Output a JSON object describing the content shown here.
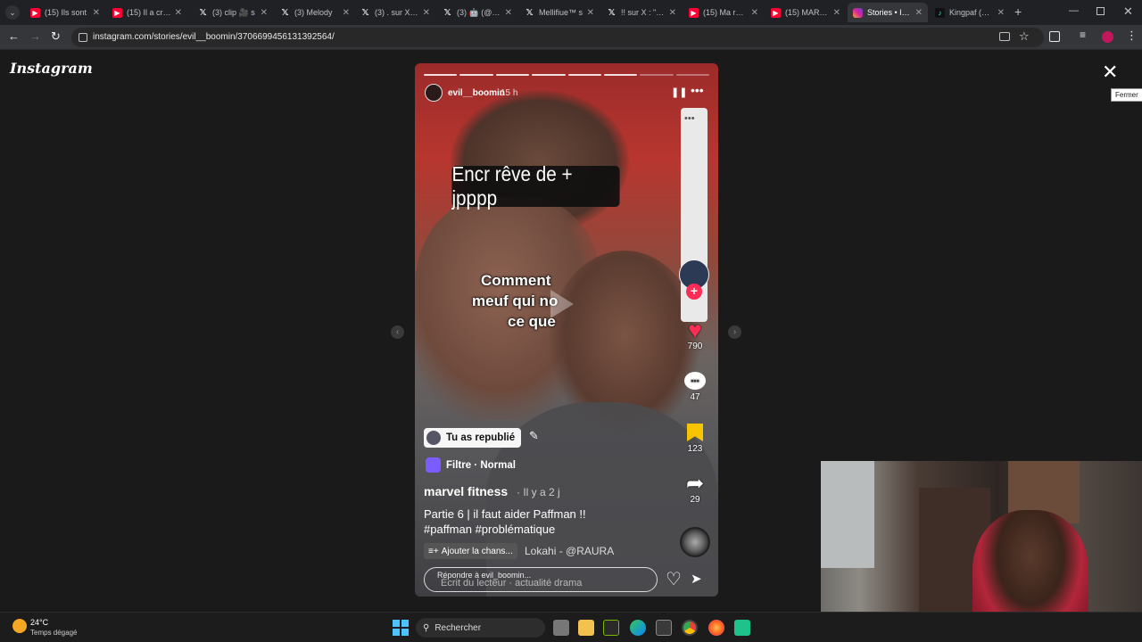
{
  "browser": {
    "tabs": [
      {
        "title": "(15) Ils sont",
        "icon": "youtube-icon"
      },
      {
        "title": "(15) Il a créé",
        "icon": "youtube-icon"
      },
      {
        "title": "(3) clip 🎥 s",
        "icon": "x-icon"
      },
      {
        "title": "(3) Melody",
        "icon": "x-icon"
      },
      {
        "title": "(3) . sur X : \"",
        "icon": "x-icon"
      },
      {
        "title": "(3) 🤖 (@TC",
        "icon": "x-icon"
      },
      {
        "title": "Mellifiue™ s",
        "icon": "x-icon"
      },
      {
        "title": "!! sur X : \"AF",
        "icon": "x-icon"
      },
      {
        "title": "(15) Ma répo",
        "icon": "youtube-icon"
      },
      {
        "title": "(15) MARVE",
        "icon": "youtube-icon"
      },
      {
        "title": "Stories • Insta",
        "icon": "instagram-icon",
        "active": true
      },
      {
        "title": "Kingpaf (@k",
        "icon": "tiktok-icon"
      }
    ],
    "new_tab": "+",
    "url": "instagram.com/stories/evil__boomin/3706699456131392564/"
  },
  "instagram": {
    "logo": "Instagram",
    "close_tooltip": "Fermer"
  },
  "story": {
    "username": "evil__boomin",
    "time": "15 h",
    "caption_box": "Encr rêve de + jpppp",
    "overlay_lines": [
      "Comment",
      "meuf qui no",
      "ce que"
    ],
    "likes": "790",
    "comments": "47",
    "saves": "123",
    "shares": "29",
    "republished": "Tu as republié",
    "filter": "Filtre · Normal",
    "account": "marvel fitness",
    "posted": "· Il y a 2 j",
    "description": "Partie 6 | il faut aider Paffman !!",
    "hashtags": "#paffman #problématique",
    "add_song": "Ajouter la chans...",
    "music": "Lokahi - @RAURA",
    "reply_label": "Répondre à evil_boomin...",
    "reply_placeholder": "Écrit du lecteur · actualité drama"
  },
  "taskbar": {
    "temperature": "24°C",
    "weather": "Temps dégagé",
    "search": "Rechercher"
  },
  "colors": {
    "like": "#ff2d55",
    "save": "#f7c500",
    "add": "#fe2c55"
  }
}
